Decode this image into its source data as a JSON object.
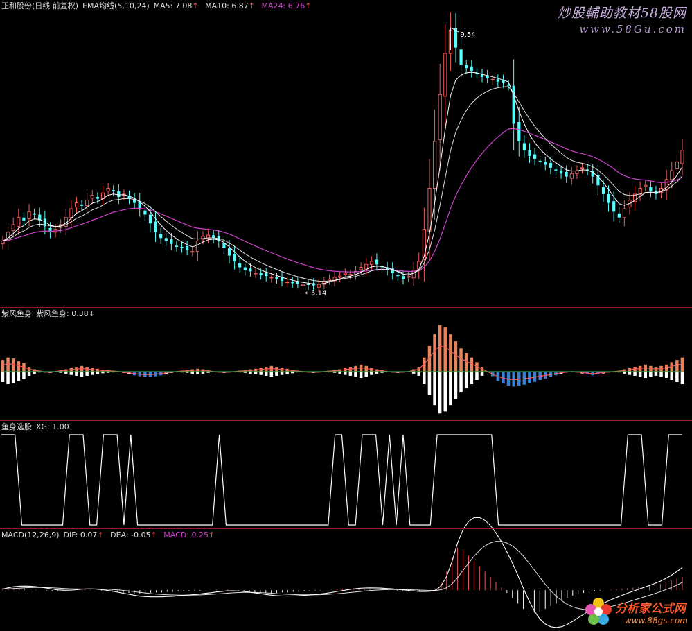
{
  "colors": {
    "up": "#f05a5a",
    "down": "#54ffff",
    "white": "#ffffff",
    "magenta": "#d040d0",
    "ma10": "#e0e0e0",
    "bar_up": "#e8825a",
    "bar_down": "#3a7fd9",
    "bar_white": "#ffffff",
    "bar_green": "#2ea84a",
    "separator": "#8a1c2c",
    "text": "#dddddd"
  },
  "main": {
    "title": "正和股份(日线 前复权)",
    "indicator": "EMA均线(5,10,24)",
    "ma5_label": "MA5: 7.08",
    "ma10_label": "MA10: 6.87",
    "ma24_label": "MA24: 6.76",
    "high_label": "9.54",
    "low_label": "←5.14"
  },
  "panel2": {
    "name": "紫风鱼身",
    "value_label": "紫风鱼身: 0.38"
  },
  "panel3": {
    "name": "鱼身选股",
    "value_label": "XG: 1.00"
  },
  "panel4": {
    "name": "MACD(12,26,9)",
    "dif_label": "DIF: 0.07",
    "dea_label": "DEA: -0.05",
    "macd_label": "MACD: 0.25"
  },
  "watermark_top": {
    "text": "炒股輔助教材58股网",
    "url": "www.58Gu.com"
  },
  "watermark_bottom": {
    "text": "分析家公式网",
    "url": "www.88gs.com"
  },
  "chart_data": [
    {
      "type": "candlestick",
      "title": "正和股份(日线 前复权)",
      "ylim": [
        4.9,
        9.8
      ],
      "annotations": [
        {
          "label": "9.54",
          "value": 9.54
        },
        {
          "label": "←5.14",
          "value": 5.14
        }
      ],
      "close": [
        5.9,
        6.05,
        6.18,
        6.3,
        6.25,
        6.4,
        6.35,
        6.25,
        6.15,
        6.05,
        6.1,
        6.18,
        6.3,
        6.45,
        6.55,
        6.5,
        6.6,
        6.68,
        6.62,
        6.72,
        6.8,
        6.75,
        6.65,
        6.7,
        6.62,
        6.55,
        6.45,
        6.35,
        6.2,
        6.05,
        5.95,
        5.9,
        5.85,
        5.8,
        5.78,
        5.75,
        5.72,
        5.9,
        5.98,
        6.0,
        5.95,
        5.9,
        5.78,
        5.65,
        5.55,
        5.45,
        5.4,
        5.38,
        5.35,
        5.32,
        5.3,
        5.28,
        5.25,
        5.22,
        5.2,
        5.18,
        5.17,
        5.16,
        5.15,
        5.14,
        5.16,
        5.2,
        5.25,
        5.28,
        5.3,
        5.35,
        5.33,
        5.38,
        5.45,
        5.5,
        5.55,
        5.5,
        5.45,
        5.4,
        5.35,
        5.3,
        5.25,
        5.3,
        5.4,
        5.55,
        6.1,
        6.8,
        7.6,
        8.4,
        9.1,
        9.5,
        9.2,
        8.9,
        8.85,
        8.8,
        8.75,
        8.7,
        8.68,
        8.66,
        8.62,
        8.6,
        8.55,
        7.9,
        7.6,
        7.45,
        7.35,
        7.3,
        7.25,
        7.2,
        7.15,
        7.1,
        7.05,
        7.0,
        7.05,
        7.1,
        7.15,
        7.1,
        7.0,
        6.85,
        6.7,
        6.55,
        6.4,
        6.3,
        6.45,
        6.6,
        6.7,
        6.8,
        6.85,
        6.75,
        6.7,
        6.8,
        6.95,
        7.1,
        7.25,
        7.45
      ],
      "series": [
        {
          "name": "MA5",
          "values": []
        },
        {
          "name": "MA10",
          "values": []
        },
        {
          "name": "MA24",
          "values": []
        }
      ]
    },
    {
      "type": "bar",
      "title": "紫风鱼身",
      "ylim": [
        -1.0,
        1.1
      ],
      "values": [
        0.25,
        0.3,
        0.28,
        0.22,
        0.18,
        0.1,
        0.05,
        0.02,
        -0.02,
        -0.03,
        0.0,
        0.03,
        0.05,
        0.08,
        0.1,
        0.12,
        0.1,
        0.08,
        0.06,
        0.04,
        0.03,
        0.02,
        0.0,
        -0.03,
        -0.05,
        -0.08,
        -0.1,
        -0.12,
        -0.12,
        -0.1,
        -0.08,
        -0.05,
        -0.03,
        0.0,
        0.02,
        0.03,
        0.05,
        0.06,
        0.05,
        0.03,
        0.0,
        -0.02,
        -0.03,
        -0.02,
        0.0,
        0.02,
        0.03,
        0.05,
        0.06,
        0.08,
        0.1,
        0.12,
        0.1,
        0.08,
        0.06,
        0.04,
        0.02,
        0.0,
        -0.02,
        -0.03,
        -0.02,
        0.0,
        0.02,
        0.03,
        0.05,
        0.08,
        0.1,
        0.12,
        0.15,
        0.12,
        0.08,
        0.05,
        0.03,
        0.0,
        -0.02,
        -0.03,
        -0.02,
        0.0,
        0.05,
        0.1,
        0.3,
        0.55,
        0.8,
        1.0,
        0.95,
        0.8,
        0.65,
        0.5,
        0.4,
        0.3,
        0.2,
        0.1,
        0.0,
        -0.1,
        -0.2,
        -0.25,
        -0.3,
        -0.32,
        -0.3,
        -0.28,
        -0.25,
        -0.22,
        -0.18,
        -0.15,
        -0.12,
        -0.08,
        -0.05,
        -0.02,
        0.0,
        -0.02,
        -0.04,
        -0.06,
        -0.08,
        -0.06,
        -0.04,
        -0.02,
        0.0,
        0.02,
        0.05,
        0.08,
        0.1,
        0.12,
        0.15,
        0.12,
        0.1,
        0.12,
        0.15,
        0.2,
        0.25,
        0.3
      ]
    },
    {
      "type": "line",
      "title": "鱼身选股",
      "ylim": [
        0,
        1
      ],
      "values": [
        1,
        1,
        1,
        0,
        0,
        0,
        0,
        0,
        0,
        0,
        1,
        1,
        1,
        0,
        0,
        1,
        1,
        1,
        0,
        1,
        0,
        0,
        0,
        0,
        0,
        0,
        0,
        0,
        0,
        0,
        0,
        0,
        1,
        0,
        0,
        0,
        0,
        0,
        0,
        0,
        0,
        0,
        0,
        0,
        0,
        0,
        0,
        0,
        0,
        1,
        1,
        0,
        0,
        1,
        1,
        1,
        0,
        1,
        0,
        1,
        0,
        0,
        0,
        0,
        1,
        1,
        1,
        1,
        1,
        1,
        1,
        1,
        1,
        0,
        0,
        0,
        0,
        0,
        0,
        0,
        0,
        0,
        0,
        0,
        0,
        0,
        0,
        0,
        0,
        0,
        0,
        0,
        1,
        1,
        1,
        0,
        0,
        0,
        1,
        1,
        1
      ]
    },
    {
      "type": "bar",
      "title": "MACD(12,26,9)",
      "ylim": [
        -0.7,
        0.9
      ],
      "values": [
        0.04,
        0.05,
        0.05,
        0.04,
        0.03,
        0.02,
        0.01,
        0.0,
        -0.01,
        -0.02,
        -0.02,
        -0.01,
        0.0,
        0.01,
        0.02,
        0.02,
        0.01,
        0.0,
        -0.01,
        -0.02,
        -0.03,
        -0.04,
        -0.05,
        -0.05,
        -0.06,
        -0.06,
        -0.05,
        -0.05,
        -0.04,
        -0.04,
        -0.03,
        -0.03,
        -0.02,
        -0.02,
        -0.02,
        -0.01,
        -0.01,
        0.0,
        0.0,
        0.01,
        0.01,
        0.01,
        0.0,
        -0.01,
        -0.02,
        -0.03,
        -0.04,
        -0.04,
        -0.05,
        -0.05,
        -0.05,
        -0.04,
        -0.04,
        -0.03,
        -0.03,
        -0.02,
        -0.02,
        -0.01,
        -0.01,
        0.0,
        0.01,
        0.02,
        0.02,
        0.03,
        0.03,
        0.03,
        0.02,
        0.02,
        0.01,
        0.01,
        0.0,
        0.0,
        -0.01,
        -0.01,
        -0.02,
        -0.02,
        -0.02,
        -0.01,
        0.0,
        0.03,
        0.15,
        0.35,
        0.6,
        0.8,
        0.75,
        0.65,
        0.55,
        0.45,
        0.35,
        0.25,
        0.15,
        0.05,
        -0.05,
        -0.15,
        -0.25,
        -0.35,
        -0.4,
        -0.42,
        -0.4,
        -0.35,
        -0.3,
        -0.25,
        -0.2,
        -0.15,
        -0.1,
        -0.07,
        -0.05,
        -0.03,
        -0.02,
        -0.01,
        0.0,
        0.01,
        0.02,
        0.03,
        0.04,
        0.05,
        0.06,
        0.07,
        0.08,
        0.1,
        0.12,
        0.15,
        0.18,
        0.22,
        0.25
      ]
    }
  ]
}
